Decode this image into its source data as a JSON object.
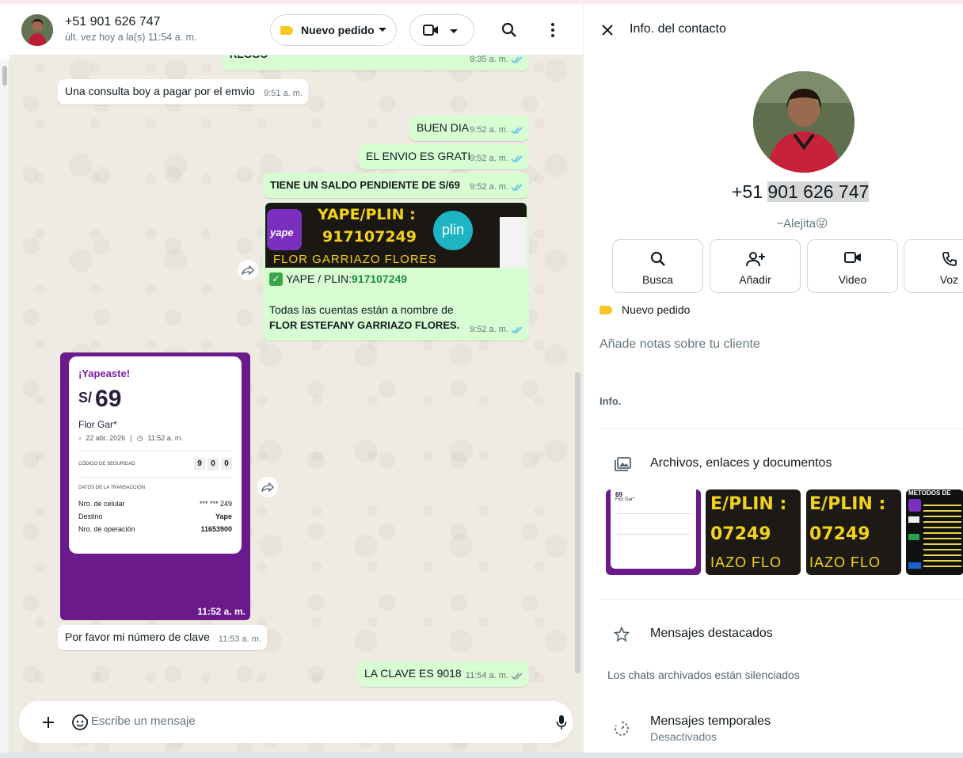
{
  "chat_header": {
    "contact_name": "+51 901 626 747",
    "last_seen": "últ. vez hoy a la(s) 11:54 a. m.",
    "label_button": "Nuevo pedido"
  },
  "messages": {
    "m0": {
      "text": "REGGO",
      "time": "9:35 a. m."
    },
    "m1": {
      "text": "Una consulta boy a pagar por el emvio",
      "time": "9:51 a. m."
    },
    "m2": {
      "text": "BUEN DIA",
      "time": "9:52 a. m."
    },
    "m3": {
      "text": "EL ENVIO ES GRATI",
      "time": "9:52 a. m."
    },
    "m4": {
      "text": "TIENE UN SALDO PENDIENTE DE S/69",
      "time": "9:52 a. m."
    },
    "m5": {
      "image_title": "YAPE/PLIN :",
      "image_number": "917107249",
      "image_name": "FLOR GARRIAZO FLORES",
      "image_plin": "plin",
      "image_yape": "yape",
      "line1_prefix": "YAPE / PLIN: ",
      "line1_number": "917107249",
      "line2": "Todas las cuentas están a nombre de",
      "line3": "FLOR ESTEFANY GARRIAZO FLORES.",
      "time": "9:52 a. m."
    },
    "m6": {
      "receipt_title": "¡Yapeaste!",
      "receipt_currency": "S/",
      "receipt_amount": "69",
      "receipt_name": "Flor Gar*",
      "receipt_date": "22 abr. 2026",
      "receipt_time": "11:52 a. m.",
      "security_label": "CÓDIGO DE SEGURIDAD",
      "security_digits": [
        "9",
        "0",
        "0"
      ],
      "tx_header": "DATOS DE LA TRANSACCIÓN",
      "rows": [
        {
          "label": "Nro. de celular",
          "value": "*** *** 249"
        },
        {
          "label": "Destino",
          "value": "Yape"
        },
        {
          "label": "Nro. de operación",
          "value": "11653900"
        }
      ],
      "time": "11:52 a. m."
    },
    "m7": {
      "text": "Por favor mi número de clave",
      "time": "11:53 a. m."
    },
    "m8": {
      "text": "LA CLAVE ES 9018",
      "time": "11:54 a. m."
    }
  },
  "composer": {
    "placeholder": "Escribe un mensaje"
  },
  "contact_info": {
    "title": "Info. del contacto",
    "phone_prefix": "+51 ",
    "phone_rest": "901 626 747",
    "push_name": "~Alejita",
    "push_emoji": "😜",
    "actions": [
      "Busca",
      "Añadir",
      "Video",
      "Voz"
    ],
    "label": "Nuevo pedido",
    "notes_placeholder": "Añade notas sobre tu cliente",
    "info_header": "Info.",
    "media_label": "Archivos, enlaces y documentos",
    "starred_label": "Mensajes destacados",
    "archived_note": "Los chats archivados están silenciados",
    "temporary_label": "Mensajes temporales",
    "temporary_status": "Desactivados",
    "thumb_texts": [
      "E/PLIN :",
      "07249",
      "IAZO FLO"
    ],
    "thumb4_title": "METODOS DE"
  },
  "colors": {
    "outgoing_bubble": "#d9fdd3",
    "tick_blue": "#53bdeb",
    "label_yellow": "#f7c724",
    "yape_purple": "#6b1a8c"
  }
}
